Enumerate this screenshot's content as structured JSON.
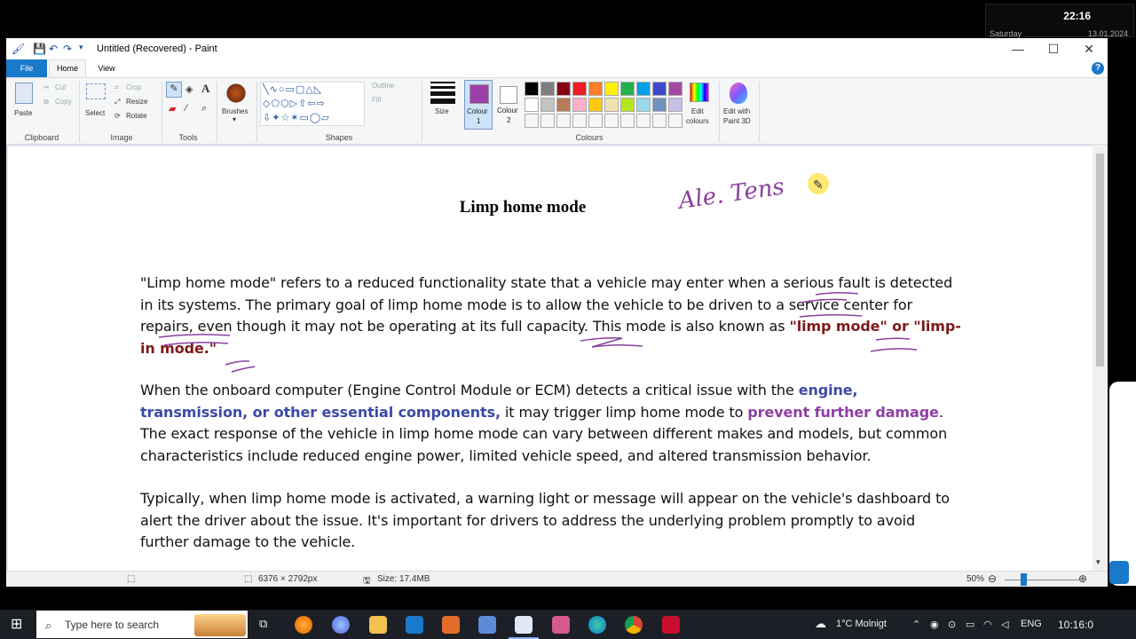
{
  "clock": {
    "time": "22:16",
    "day": "Saturday",
    "date": "13.01.2024"
  },
  "window": {
    "title": "Untitled (Recovered) - Paint",
    "tabs": {
      "file": "File",
      "home": "Home",
      "view": "View",
      "help": "?"
    }
  },
  "ribbon": {
    "clipboard": {
      "paste": "Paste",
      "cut": "Cut",
      "copy": "Copy",
      "label": "Clipboard"
    },
    "image": {
      "select": "Select",
      "crop": "Crop",
      "resize": "Resize",
      "rotate": "Rotate",
      "label": "Image"
    },
    "tools": {
      "label": "Tools"
    },
    "brushes": {
      "label": "Brushes"
    },
    "shapes": {
      "outline": "Outline",
      "fill": "Fill",
      "label": "Shapes"
    },
    "size": {
      "label": "Size"
    },
    "colour1": {
      "label_line1": "Colour",
      "label_line2": "1",
      "color": "#9c3fa8"
    },
    "colour2": {
      "label_line1": "Colour",
      "label_line2": "2",
      "color": "#ffffff"
    },
    "colours": {
      "label": "Colours",
      "row1": [
        "#000000",
        "#7f7f7f",
        "#880015",
        "#ed1c24",
        "#ff7f27",
        "#fff200",
        "#22b14c",
        "#00a2e8",
        "#3f48cc",
        "#a349a4"
      ],
      "row2": [
        "#ffffff",
        "#c3c3c3",
        "#b97a57",
        "#ffaec9",
        "#ffc90e",
        "#efe4b0",
        "#b5e61d",
        "#99d9ea",
        "#7092be",
        "#c8bfe7"
      ]
    },
    "edit_colours": {
      "line1": "Edit",
      "line2": "colours"
    },
    "paint3d": {
      "line1": "Edit with",
      "line2": "Paint 3D"
    }
  },
  "document": {
    "title": "Limp home mode",
    "p1": {
      "text": "\"Limp home mode\" refers to a reduced functionality state that a vehicle may enter when a serious fault is detected in its systems. The primary goal of limp home mode is to allow the vehicle to be driven to a service center for repairs, even though it may not be operating at its full capacity. This mode is also known as ",
      "bold": "\"limp mode\" or \"limp-in mode.\""
    },
    "p2": {
      "a": "When the onboard computer (Engine Control Module or ECM) detects a critical issue with the ",
      "b": "engine, transmission, or other essential components,",
      "c": " it may trigger limp home mode to ",
      "d": "prevent further damage",
      "e": ". The exact response of the vehicle in limp home mode can vary between different makes and models, but common characteristics include reduced engine power, limited vehicle speed, and altered transmission behavior."
    },
    "p3": "Typically, when limp home mode is activated, a warning light or message will appear on the vehicle's dashboard to alert the driver about the issue. It's important for drivers to address the underlying problem promptly to avoid further damage to the vehicle.",
    "handwriting": "Ale. Tens"
  },
  "status": {
    "dimensions": "6376 × 2792px",
    "size": "Size: 17.4MB",
    "zoom": "50%"
  },
  "taskbar": {
    "search_placeholder": "Type here to search",
    "weather": "1°C  Molnigt",
    "lang": "ENG",
    "time": "10:16:0"
  }
}
